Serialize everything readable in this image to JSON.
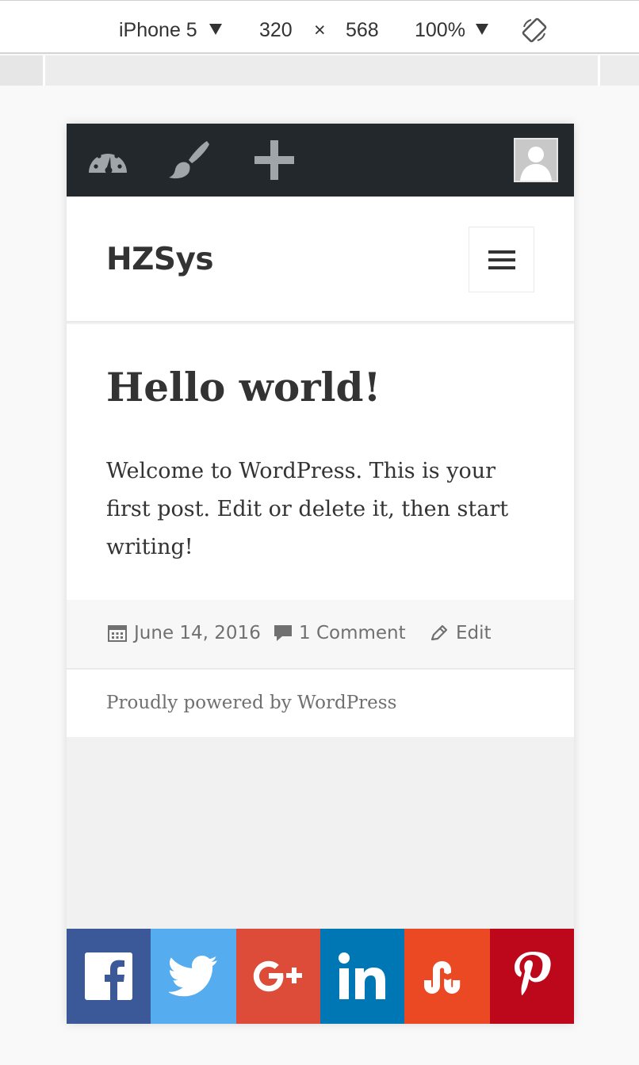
{
  "devtools": {
    "device": "iPhone 5",
    "width": "320",
    "times": "×",
    "height": "568",
    "zoom": "100%",
    "icons": {
      "device_caret": "caret-down-icon",
      "zoom_caret": "caret-down-icon",
      "rotate": "rotate-icon"
    }
  },
  "adminbar": {
    "icons": [
      "dashboard-icon",
      "customize-brush-icon",
      "new-content-plus-icon",
      "user-avatar"
    ]
  },
  "site": {
    "title": "HZSys",
    "menu_icon": "hamburger-menu-icon"
  },
  "post": {
    "title": "Hello world!",
    "content": "Welcome to WordPress. This is your first post. Edit or delete it, then start writing!",
    "date": "June 14, 2016",
    "comments": "1 Comment",
    "edit": "Edit",
    "icons": [
      "calendar-icon",
      "comment-icon",
      "pencil-icon"
    ]
  },
  "footer": {
    "credit": "Proudly powered by WordPress"
  },
  "share": {
    "buttons": [
      {
        "network": "Facebook",
        "icon": "facebook-icon",
        "color": "#3b5998"
      },
      {
        "network": "Twitter",
        "icon": "twitter-icon",
        "color": "#55acee"
      },
      {
        "network": "Google+",
        "icon": "google-plus-icon",
        "color": "#dd4b39"
      },
      {
        "network": "LinkedIn",
        "icon": "linkedin-icon",
        "color": "#0077b5"
      },
      {
        "network": "StumbleUpon",
        "icon": "stumbleupon-icon",
        "color": "#eb4924"
      },
      {
        "network": "Pinterest",
        "icon": "pinterest-icon",
        "color": "#bd081c"
      }
    ]
  },
  "colors": {
    "adminbar": "#23282d",
    "text": "#333333",
    "meta_text": "#707070",
    "page_bg": "#f1f1f1"
  }
}
